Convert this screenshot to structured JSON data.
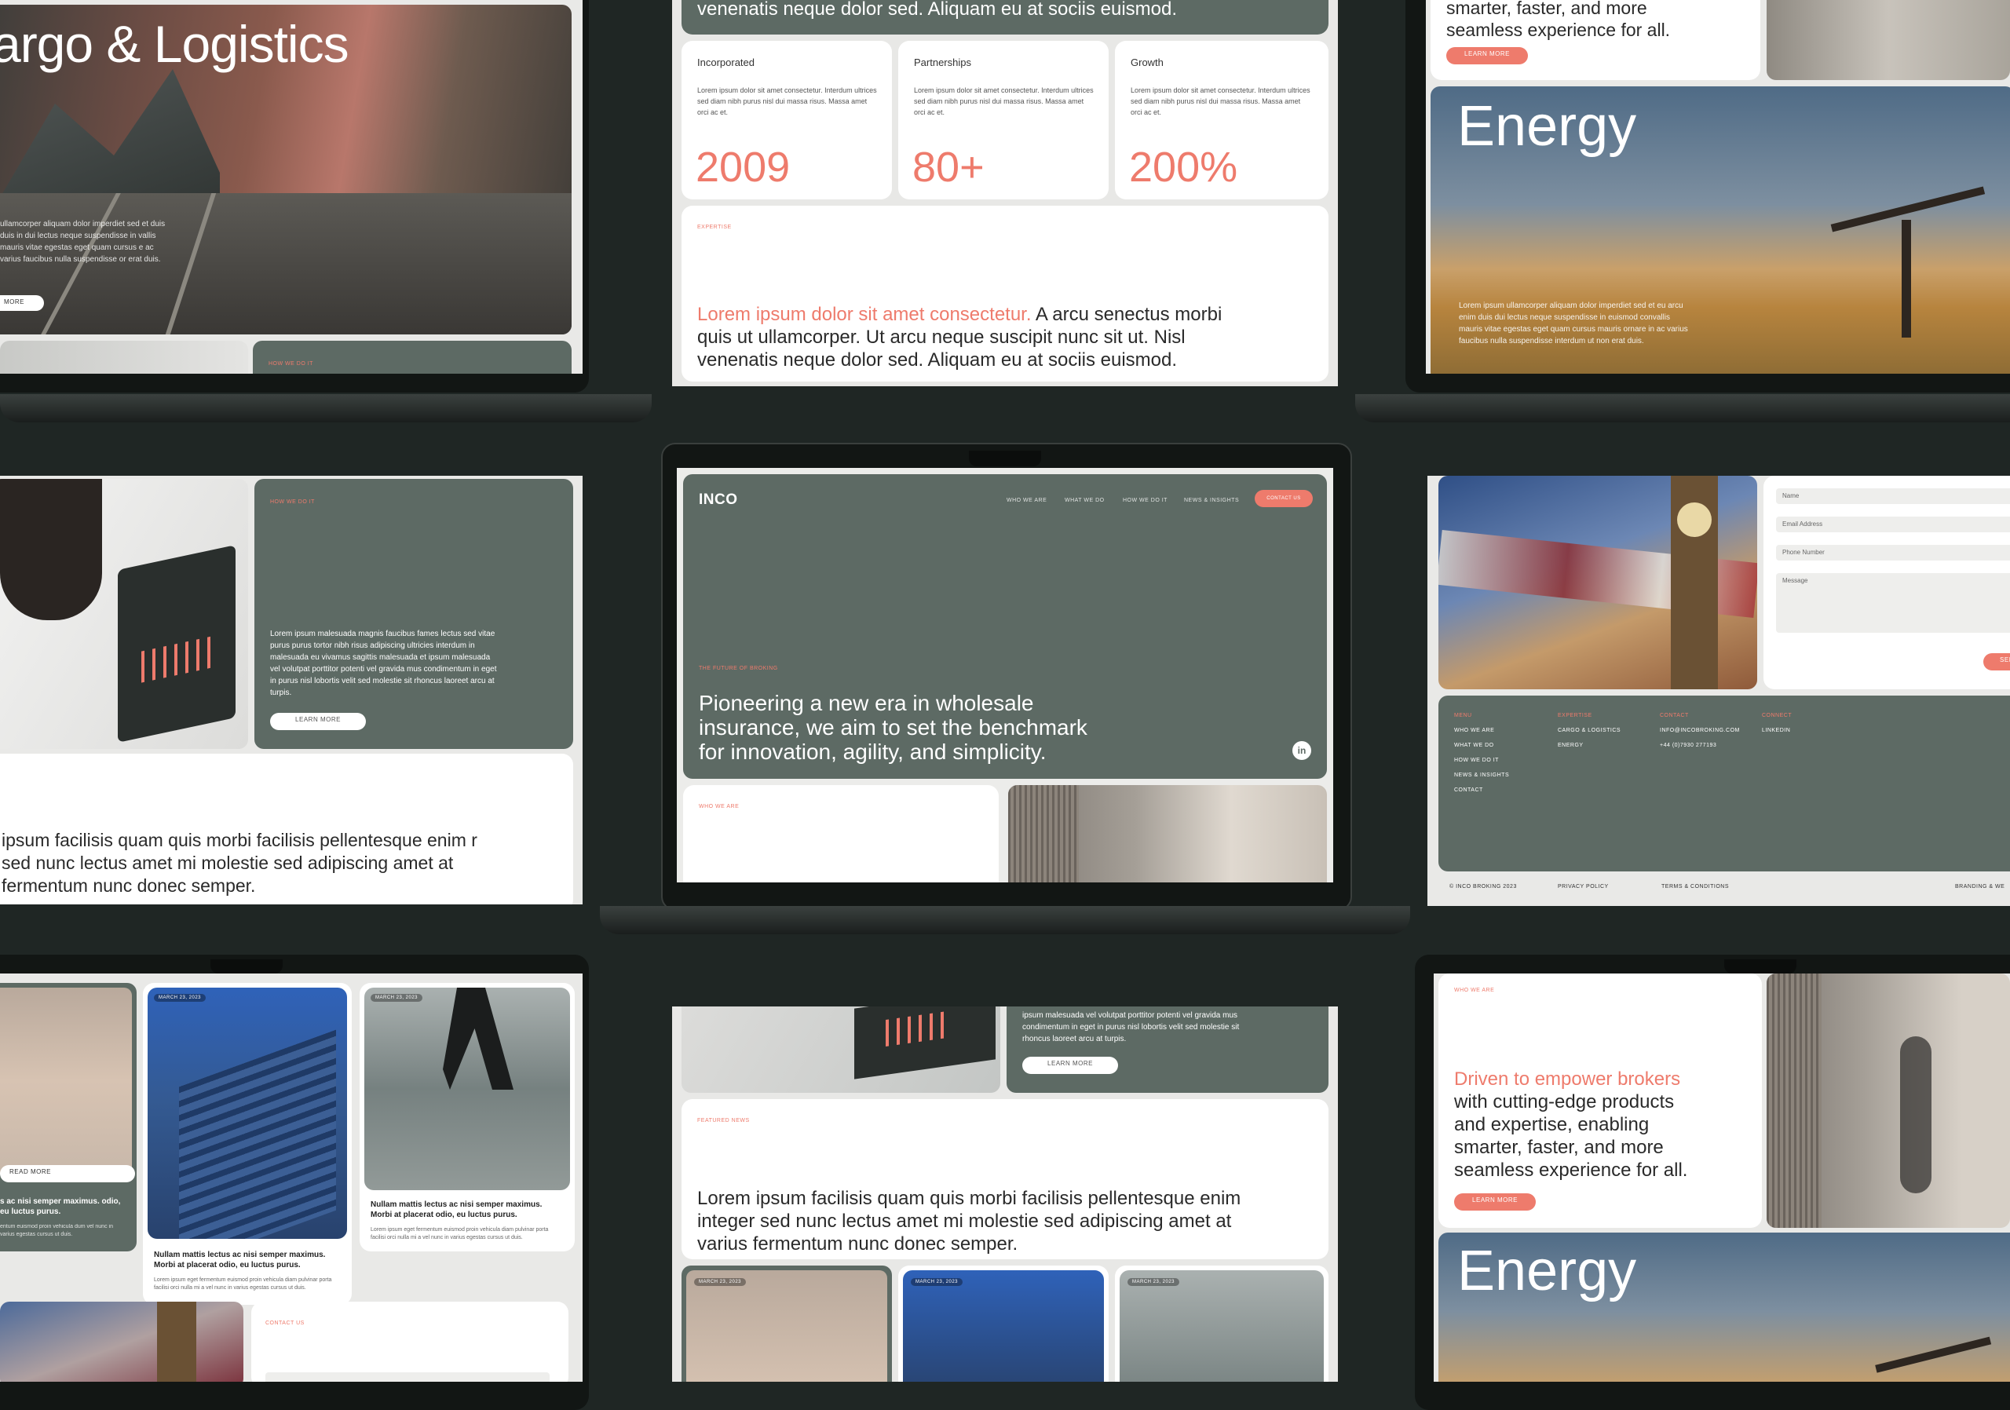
{
  "cargo": {
    "title": "argo & Logistics",
    "body": "ullamcorper aliquam dolor imperdiet sed et duis duis in dui lectus neque suspendisse in vallis mauris vitae egestas eget quam cursus e ac varius faucibus nulla suspendisse or erat duis.",
    "btn": "MORE",
    "strip_label": "HOW WE DO IT"
  },
  "stats": {
    "top_text": "venenatis neque dolor sed. Aliquam eu at sociis euismod.",
    "cards": [
      {
        "label": "Incorporated",
        "body": "Lorem ipsum dolor sit amet consectetur. Interdum ultrices sed diam nibh purus nisl dui massa risus. Massa amet orci ac et.",
        "value": "2009"
      },
      {
        "label": "Partnerships",
        "body": "Lorem ipsum dolor sit amet consectetur. Interdum ultrices sed diam nibh purus nisl dui massa risus. Massa amet orci ac et.",
        "value": "80+"
      },
      {
        "label": "Growth",
        "body": "Lorem ipsum dolor sit amet consectetur. Interdum ultrices sed diam nibh purus nisl dui massa risus. Massa amet orci ac et.",
        "value": "200%"
      }
    ],
    "expertise_label": "EXPERTISE",
    "quote_highlight": "Lorem ipsum dolor sit amet consectetur.",
    "quote_rest": " A arcu senectus morbi quis ut ullamcorper. Ut arcu neque suscipit nunc sit ut. Nisl venenatis neque dolor sed. Aliquam eu at sociis euismod."
  },
  "energy_top": {
    "intro": "smarter, faster, and more seamless experience for all.",
    "btn": "LEARN MORE",
    "title": "Energy",
    "body": "Lorem ipsum ullamcorper aliquam dolor imperdiet sed et eu arcu enim duis dui lectus neque suspendisse in euismod convallis mauris vitae egestas eget quam cursus mauris ornare in ac varius faucibus nulla suspendisse interdum ut non erat duis."
  },
  "howwedoit": {
    "label": "HOW WE DO IT",
    "body": "Lorem ipsum malesuada magnis faucibus fames lectus sed vitae purus purus tortor nibh risus adipiscing ultricies interdum in malesuada eu vivamus sagittis malesuada et ipsum malesuada vel volutpat porttitor potenti vel gravida mus condimentum in eget in purus nisl lobortis velit sed molestie sit rhoncus laoreet arcu at turpis.",
    "btn": "LEARN MORE",
    "quote": "ipsum facilisis quam quis morbi facilisis pellentesque enim r sed nunc lectus amet mi molestie sed adipiscing amet at fermentum nunc donec semper."
  },
  "hero": {
    "logo": "INCO",
    "nav": [
      "WHO WE ARE",
      "WHAT WE DO",
      "HOW WE DO IT",
      "NEWS & INSIGHTS"
    ],
    "cta": "CONTACT US",
    "eyebrow": "THE FUTURE OF BROKING",
    "headline": "Pioneering a new era in wholesale insurance, we aim to set the benchmark for innovation, agility, and simplicity.",
    "social": "in",
    "who_label": "WHO WE ARE"
  },
  "contact": {
    "fields": [
      "Name",
      "Email Address",
      "Phone Number",
      "Message"
    ],
    "send": "SEN",
    "footer_cols": [
      {
        "head": "MENU",
        "items": [
          "WHO WE ARE",
          "WHAT WE DO",
          "HOW WE DO IT",
          "NEWS & INSIGHTS",
          "CONTACT"
        ]
      },
      {
        "head": "EXPERTISE",
        "items": [
          "CARGO & LOGISTICS",
          "ENERGY"
        ]
      },
      {
        "head": "CONTACT",
        "items": [
          "INFO@INCOBROKING.COM",
          "+44 (0)7930 277193"
        ]
      },
      {
        "head": "CONNECT",
        "items": [
          "LINKEDIN"
        ]
      }
    ],
    "legal": [
      "© INCO BROKING 2023",
      "PRIVACY POLICY",
      "TERMS & CONDITIONS",
      "BRANDING & WE"
    ]
  },
  "news_left": {
    "read_more": "READ MORE",
    "partial_title": "s ac nisi semper maximus. odio, eu luctus purus.",
    "partial_body": "entum euismod proin vehicula dum vel nunc in varius egestas cursus ut duis.",
    "cards": [
      {
        "date": "MARCH 23, 2023",
        "title": "Nullam mattis lectus ac nisi semper maximus. Morbi at placerat odio, eu luctus purus.",
        "body": "Lorem ipsum eget fermentum euismod proin vehicula diam pulvinar porta facilisi orci nulla mi a vel nunc in varius egestas cursus ut duis."
      },
      {
        "date": "MARCH 23, 2023",
        "title": "Nullam mattis lectus ac nisi semper maximus. Morbi at placerat odio, eu luctus purus.",
        "body": "Lorem ipsum eget fermentum euismod proin vehicula diam pulvinar porta facilisi orci nulla mi a vel nunc in varius egestas cursus ut duis."
      }
    ],
    "contact_label": "CONTACT US"
  },
  "news_center": {
    "top_body": "ipsum malesuada vel volutpat porttitor potenti vel gravida mus condimentum in eget in purus nisl lobortis velit sed molestie sit rhoncus laoreet arcu at turpis.",
    "btn": "LEARN MORE",
    "featured_label": "FEATURED NEWS",
    "quote": "Lorem ipsum facilisis quam quis morbi facilisis pellentesque enim integer sed nunc lectus amet mi molestie sed adipiscing amet at varius fermentum nunc donec semper.",
    "dates": [
      "MARCH 23, 2023",
      "MARCH 23, 2023",
      "MARCH 23, 2023"
    ]
  },
  "who_right": {
    "label": "WHO WE ARE",
    "highlight": "Driven to empower brokers",
    "rest": "with cutting-edge products and expertise, enabling smarter, faster, and more seamless experience for all.",
    "btn": "LEARN MORE",
    "energy": "Energy"
  },
  "colors": {
    "accent": "#ee7b6c",
    "panel": "#5d6a64",
    "background": "#1f2624"
  }
}
